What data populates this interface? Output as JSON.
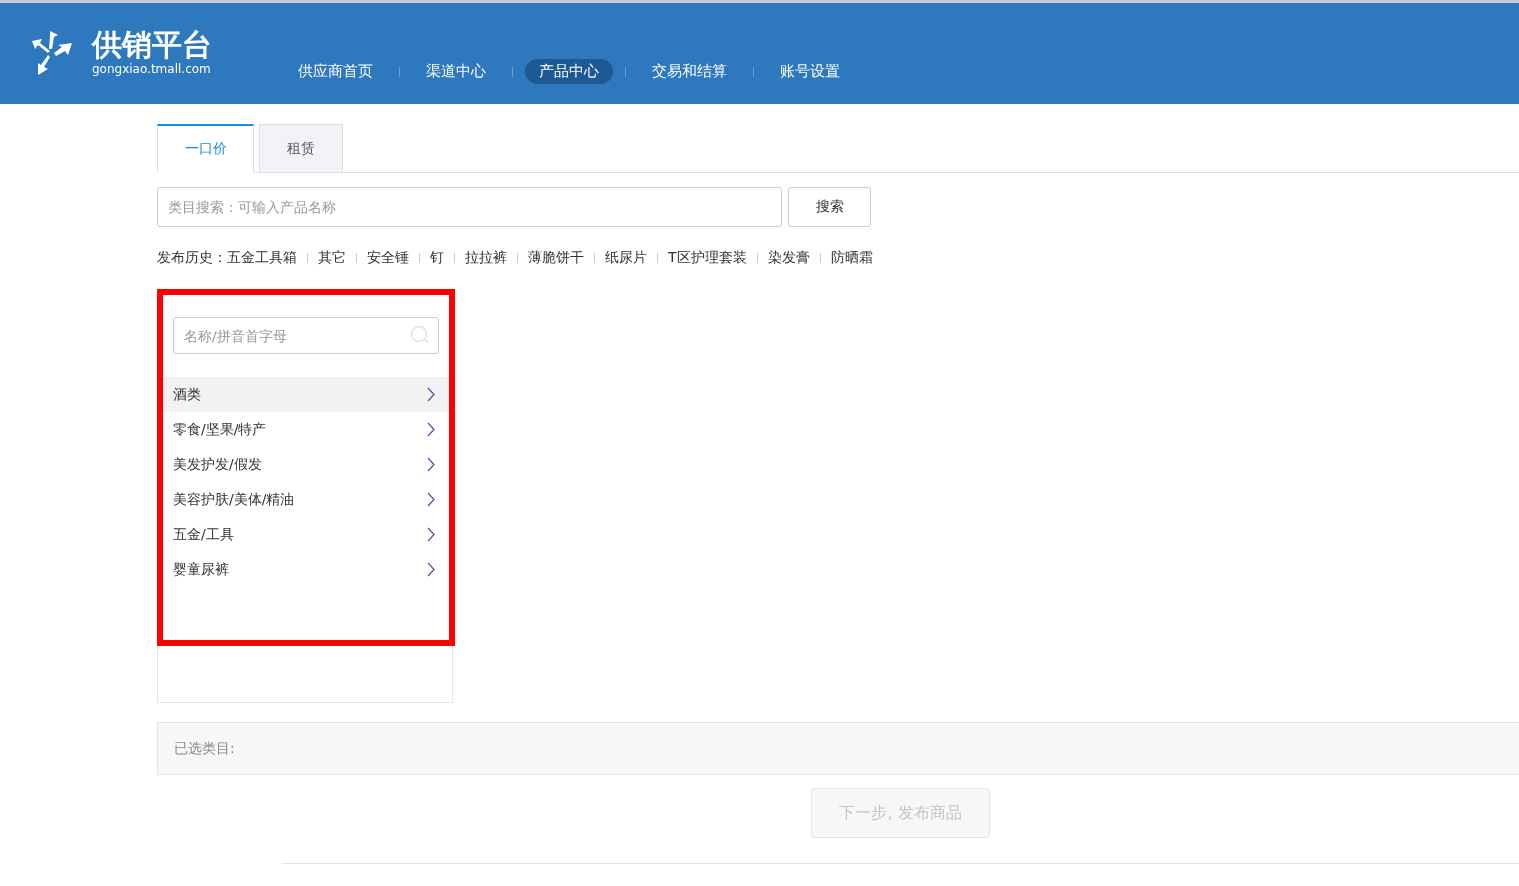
{
  "header": {
    "logo_title": "供销平台",
    "logo_subtitle": "gongxiao.tmall.com",
    "nav": [
      {
        "label": "供应商首页",
        "selected": false
      },
      {
        "label": "渠道中心",
        "selected": false
      },
      {
        "label": "产品中心",
        "selected": true
      },
      {
        "label": "交易和结算",
        "selected": false
      },
      {
        "label": "账号设置",
        "selected": false
      }
    ]
  },
  "tabs": [
    {
      "label": "一口价",
      "selected": true
    },
    {
      "label": "租赁",
      "selected": false
    }
  ],
  "search": {
    "placeholder": "类目搜索：可输入产品名称",
    "button": "搜索"
  },
  "history": {
    "label": "发布历史：",
    "items": [
      "五金工具箱",
      "其它",
      "安全锤",
      "钉",
      "拉拉裤",
      "薄脆饼干",
      "纸尿片",
      "T区护理套装",
      "染发膏",
      "防晒霜"
    ]
  },
  "category_panel": {
    "highlighted": true,
    "filter_placeholder": "名称/拼音首字母",
    "items": [
      {
        "label": "酒类",
        "selected": true
      },
      {
        "label": "零食/坚果/特产",
        "selected": false
      },
      {
        "label": "美发护发/假发",
        "selected": false
      },
      {
        "label": "美容护肤/美体/精油",
        "selected": false
      },
      {
        "label": "五金/工具",
        "selected": false
      },
      {
        "label": "婴童尿裤",
        "selected": false
      }
    ]
  },
  "selected_category": {
    "label": "已选类目:"
  },
  "next_button": {
    "label": "下一步, 发布商品",
    "disabled": true
  }
}
